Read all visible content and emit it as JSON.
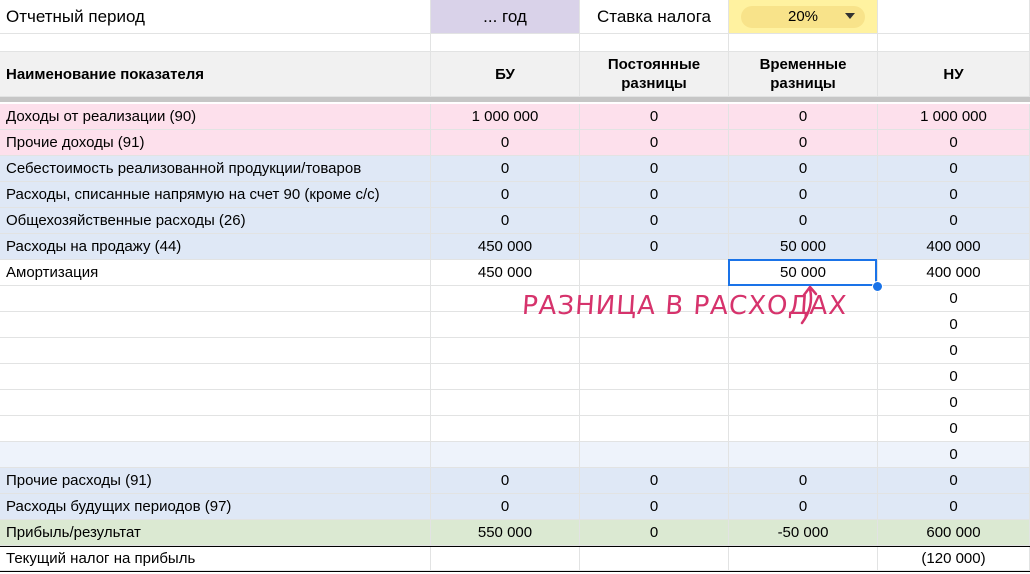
{
  "header": {
    "period_label": "Отчетный период",
    "period_value": "... год",
    "tax_label": "Ставка налога",
    "tax_value": "20%"
  },
  "columns": [
    "Наименование показателя",
    "БУ",
    "Постоянные разницы",
    "Временные разницы",
    "НУ"
  ],
  "rows": [
    {
      "name": "Доходы от реализации (90)",
      "bu": "1 000 000",
      "perm": "0",
      "temp": "0",
      "nu": "1 000 000",
      "color": "#fde0ec"
    },
    {
      "name": "Прочие доходы (91)",
      "bu": "0",
      "perm": "0",
      "temp": "0",
      "nu": "0",
      "color": "#fde0ec"
    },
    {
      "name": "Себестоимость реализованной продукции/товаров",
      "bu": "0",
      "perm": "0",
      "temp": "0",
      "nu": "0",
      "color": "#dfe8f6"
    },
    {
      "name": "Расходы, списанные напрямую на счет 90 (кроме с/с)",
      "bu": "0",
      "perm": "0",
      "temp": "0",
      "nu": "0",
      "color": "#dfe8f6"
    },
    {
      "name": "Общехозяйственные расходы (26)",
      "bu": "0",
      "perm": "0",
      "temp": "0",
      "nu": "0",
      "color": "#dfe8f6"
    },
    {
      "name": "Расходы на продажу (44)",
      "bu": "450 000",
      "perm": "0",
      "temp": "50 000",
      "nu": "400 000",
      "color": "#dfe8f6"
    },
    {
      "name": "Амортизация",
      "bu": "450 000",
      "perm": "",
      "temp": "50 000",
      "nu": "400 000",
      "color": "#ffffff"
    },
    {
      "name": "",
      "bu": "",
      "perm": "",
      "temp": "",
      "nu": "0",
      "color": "#ffffff"
    },
    {
      "name": "",
      "bu": "",
      "perm": "",
      "temp": "",
      "nu": "0",
      "color": "#ffffff"
    },
    {
      "name": "",
      "bu": "",
      "perm": "",
      "temp": "",
      "nu": "0",
      "color": "#ffffff"
    },
    {
      "name": "",
      "bu": "",
      "perm": "",
      "temp": "",
      "nu": "0",
      "color": "#ffffff"
    },
    {
      "name": "",
      "bu": "",
      "perm": "",
      "temp": "",
      "nu": "0",
      "color": "#ffffff"
    },
    {
      "name": "",
      "bu": "",
      "perm": "",
      "temp": "",
      "nu": "0",
      "color": "#ffffff"
    },
    {
      "name": "",
      "bu": "",
      "perm": "",
      "temp": "",
      "nu": "0",
      "color": "#eef3fb"
    },
    {
      "name": "Прочие расходы (91)",
      "bu": "0",
      "perm": "0",
      "temp": "0",
      "nu": "0",
      "color": "#dfe8f6"
    },
    {
      "name": "Расходы будущих периодов (97)",
      "bu": "0",
      "perm": "0",
      "temp": "0",
      "nu": "0",
      "color": "#dfe8f6"
    },
    {
      "name": "Прибыль/результат",
      "bu": "550 000",
      "perm": "0",
      "temp": "-50 000",
      "nu": "600 000",
      "color": "#dbe9d2"
    },
    {
      "name": "Текущий налог на прибыль",
      "bu": "",
      "perm": "",
      "temp": "",
      "nu": "(120 000)",
      "color": "#ffffff"
    }
  ],
  "annotation": "РАЗНИЦА В РАСХОДАХ",
  "icons": {
    "dropdown": "chevron-down-icon",
    "annotation_arrow": "curved-arrow-icon"
  }
}
